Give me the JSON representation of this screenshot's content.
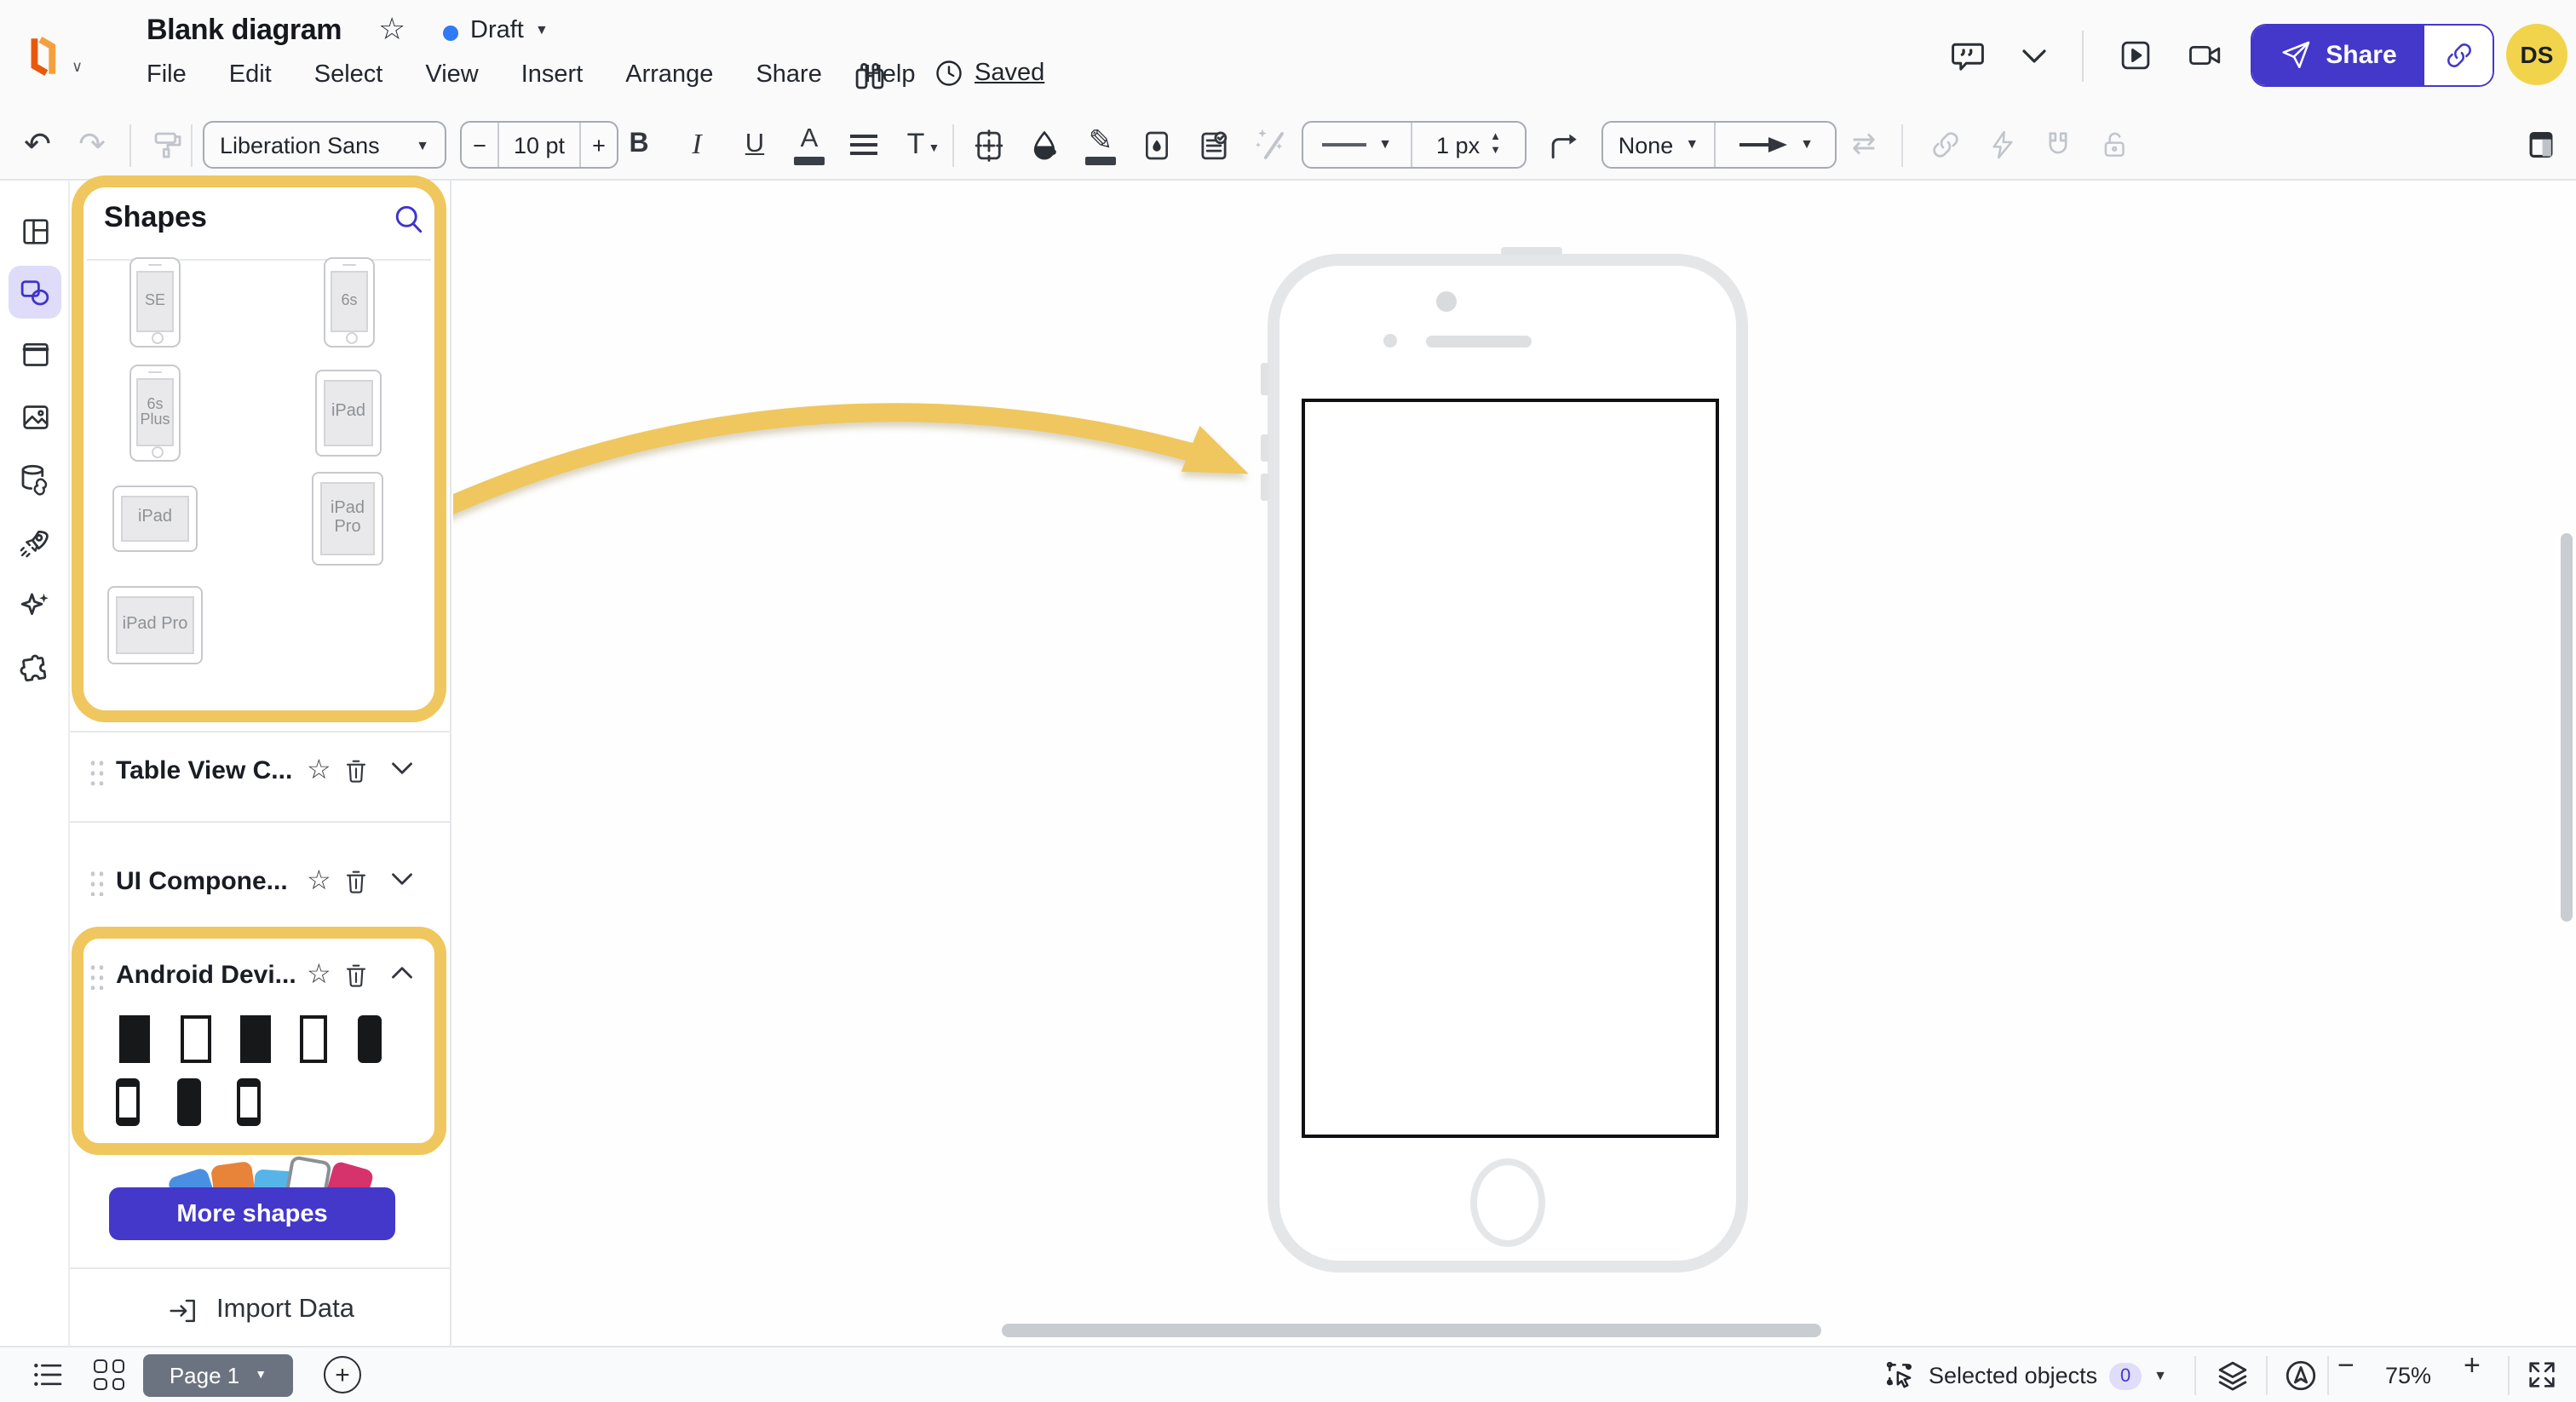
{
  "header": {
    "title": "Blank diagram",
    "status": "Draft",
    "saved_label": "Saved",
    "menus": [
      "File",
      "Edit",
      "Select",
      "View",
      "Insert",
      "Arrange",
      "Share",
      "Help"
    ],
    "share_label": "Share",
    "avatar_initials": "DS"
  },
  "toolbar": {
    "font_family": "Liberation Sans",
    "font_size": "10 pt",
    "bold_label": "B",
    "italic_label": "I",
    "underline_label": "U",
    "text_color_label": "A",
    "text_options_label": "T",
    "line_width": "1 px",
    "line_end_style": "None"
  },
  "panel": {
    "title": "Shapes",
    "devices": [
      {
        "label": "SE"
      },
      {
        "label": "6s"
      },
      {
        "label": "6s Plus"
      },
      {
        "label": "iPad"
      },
      {
        "label": "iPad"
      },
      {
        "label": "iPad Pro"
      },
      {
        "label": "iPad Pro"
      }
    ],
    "sections": [
      {
        "name": "Table View C..."
      },
      {
        "name": "UI Compone..."
      },
      {
        "name": "Android Devi..."
      }
    ],
    "more_shapes_label": "More shapes",
    "import_data_label": "Import Data"
  },
  "footer": {
    "page_label": "Page 1",
    "selected_objects_label": "Selected objects",
    "selected_count": "0",
    "zoom_level": "75%"
  },
  "icons": {
    "undo": "↶",
    "redo": "↷",
    "swap": "⇄",
    "pencil": "✎",
    "star": "☆",
    "caret_down": "▼",
    "caret_up_small": "▲",
    "line_dash": "—",
    "minus": "−",
    "plus": "+"
  },
  "colors": {
    "accent_indigo": "#4338CA",
    "highlight_yellow": "#EFC75E",
    "avatar_yellow": "#F2D44C",
    "draft_dot_blue": "#3179F5",
    "selected_badge_bg": "#DFDDF9",
    "page_button_gray": "#6C7380"
  }
}
